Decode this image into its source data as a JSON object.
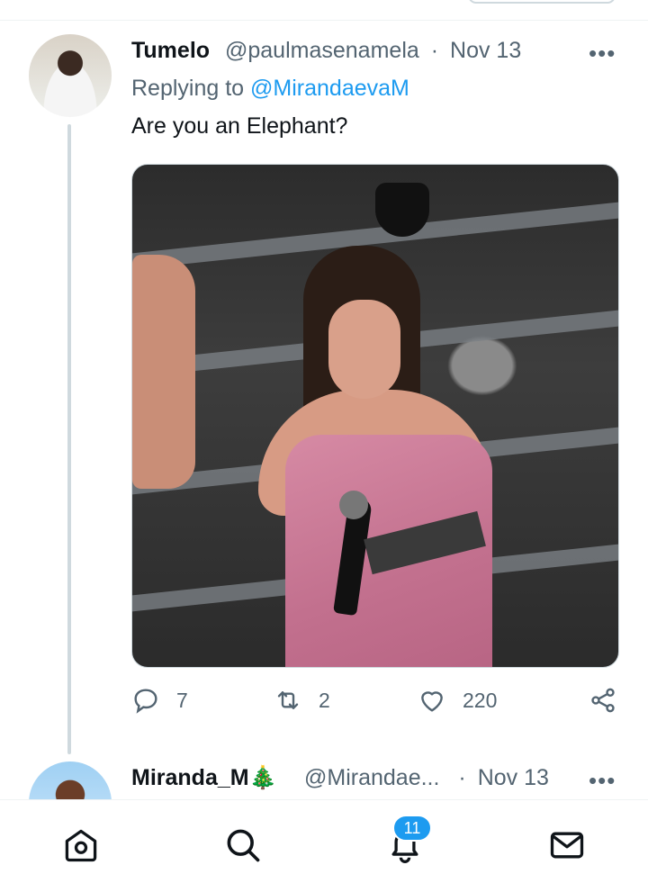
{
  "tweet": {
    "display_name": "Tumelo",
    "handle": "@paulmasenamela",
    "separator": "·",
    "date": "Nov 13",
    "replying_prefix": "Replying to",
    "replying_to": "@MirandaevaM",
    "text": "Are you an Elephant?",
    "more": "•••",
    "actions": {
      "replies": "7",
      "retweets": "2",
      "likes": "220"
    },
    "icons": [
      "reply-icon",
      "retweet-icon",
      "like-icon",
      "share-icon"
    ]
  },
  "next_tweet": {
    "display_name": "Miranda_M",
    "emoji": "🎄",
    "handle": "@Mirandae...",
    "separator": "·",
    "date": "Nov 13",
    "more": "•••"
  },
  "bottom_nav": {
    "items": [
      "home-icon",
      "search-icon",
      "notifications-icon",
      "messages-icon"
    ],
    "notification_count": "11"
  },
  "colors": {
    "accent": "#1d9bf0",
    "text": "#0f1419",
    "secondary": "#536471",
    "border": "#cfd9de"
  }
}
